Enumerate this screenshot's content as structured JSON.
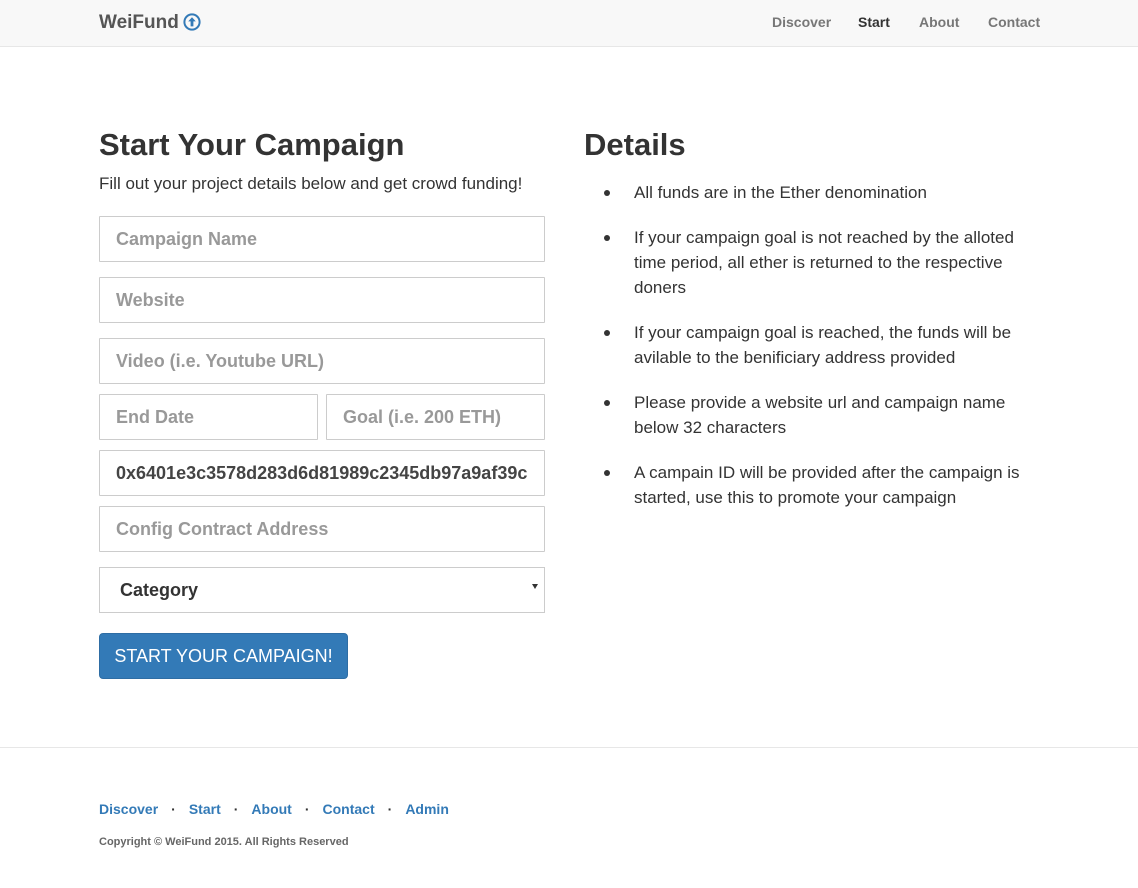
{
  "navbar": {
    "brand": "WeiFund",
    "brand_icon": "arrow-up-circle-icon",
    "links": [
      {
        "label": "Discover",
        "active": false
      },
      {
        "label": "Start",
        "active": true
      },
      {
        "label": "About",
        "active": false
      },
      {
        "label": "Contact",
        "active": false
      }
    ]
  },
  "form": {
    "title": "Start Your Campaign",
    "subtitle": "Fill out your project details below and get crowd funding!",
    "campaign_name": {
      "placeholder": "Campaign Name",
      "value": ""
    },
    "website": {
      "placeholder": "Website",
      "value": ""
    },
    "video": {
      "placeholder": "Video (i.e. Youtube URL)",
      "value": ""
    },
    "end_date": {
      "placeholder": "End Date",
      "value": ""
    },
    "goal": {
      "placeholder": "Goal (i.e. 200 ETH)",
      "value": ""
    },
    "beneficiary": {
      "value": "0x6401e3c3578d283d6d81989c2345db97a9af39c"
    },
    "config_contract": {
      "placeholder": "Config Contract Address",
      "value": ""
    },
    "category": {
      "selected": "Category"
    },
    "submit_label": "START YOUR CAMPAIGN!"
  },
  "details": {
    "title": "Details",
    "items": [
      "All funds are in the Ether denomination",
      "If your campaign goal is not reached by the alloted time period, all ether is returned to the respective doners",
      "If your campaign goal is reached, the funds will be avilable to the benificiary address provided",
      "Please provide a website url and campaign name below 32 characters",
      "A campain ID will be provided after the campaign is started, use this to promote your campaign"
    ]
  },
  "footer": {
    "links": [
      "Discover",
      "Start",
      "About",
      "Contact",
      "Admin"
    ],
    "separator": "·",
    "copyright": "Copyright © WeiFund 2015. All Rights Reserved"
  },
  "colors": {
    "accent": "#337ab7",
    "navbar_bg": "#f8f8f8",
    "text": "#333333"
  }
}
